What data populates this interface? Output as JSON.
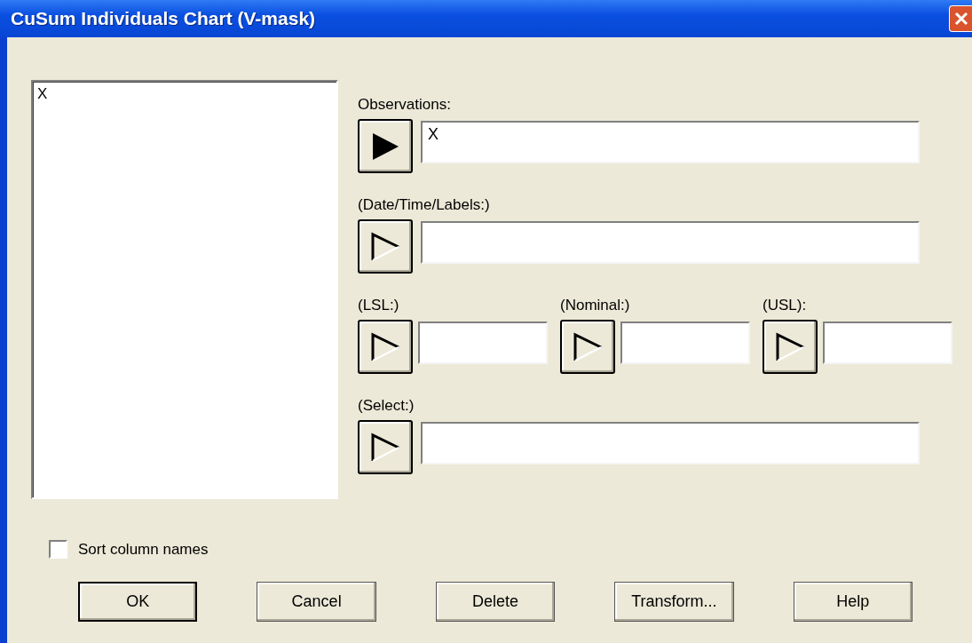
{
  "window": {
    "title": "CuSum Individuals Chart (V-mask)"
  },
  "column_list": {
    "items": [
      {
        "label": "X",
        "selected": false
      }
    ]
  },
  "full_fields": [
    {
      "label": "Observations:",
      "value": "X",
      "assigned": true
    },
    {
      "label": "(Date/Time/Labels:)",
      "assigned": false
    }
  ],
  "spec_fields": [
    {
      "label": "(LSL:)",
      "assigned": false
    },
    {
      "label": "(Nominal:)",
      "assigned": false
    },
    {
      "label": "(USL):",
      "assigned": false
    }
  ],
  "select_field": {
    "label": "(Select:)",
    "assigned": false
  },
  "sort_checkbox": {
    "label": "Sort column names",
    "checked": false
  },
  "buttons": [
    {
      "label": "OK",
      "default": true
    },
    {
      "label": "Cancel",
      "default": false
    },
    {
      "label": "Delete",
      "default": false
    },
    {
      "label": "Transform...",
      "default": false
    },
    {
      "label": "Help",
      "default": false
    }
  ]
}
